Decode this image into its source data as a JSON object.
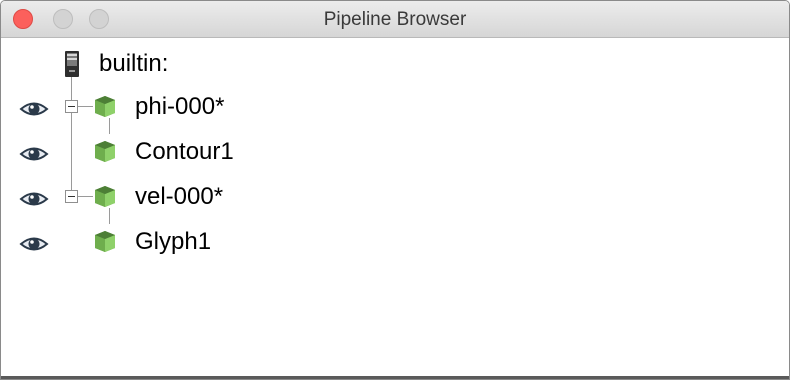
{
  "window": {
    "title": "Pipeline Browser"
  },
  "tree": {
    "root": {
      "label": "builtin:",
      "icon": "server-icon"
    },
    "items": [
      {
        "label": "phi-000*",
        "visible": true,
        "expandable": true,
        "icon": "source-cube-icon"
      },
      {
        "label": "Contour1",
        "visible": true,
        "expandable": false,
        "icon": "filter-cube-icon"
      },
      {
        "label": "vel-000*",
        "visible": true,
        "expandable": true,
        "icon": "source-cube-icon"
      },
      {
        "label": "Glyph1",
        "visible": true,
        "expandable": false,
        "icon": "filter-cube-icon"
      }
    ]
  },
  "colors": {
    "close": "#fc605c",
    "cube_front": "#8fd16a",
    "cube_side": "#5e9a42",
    "eye": "#2b3a4a"
  }
}
